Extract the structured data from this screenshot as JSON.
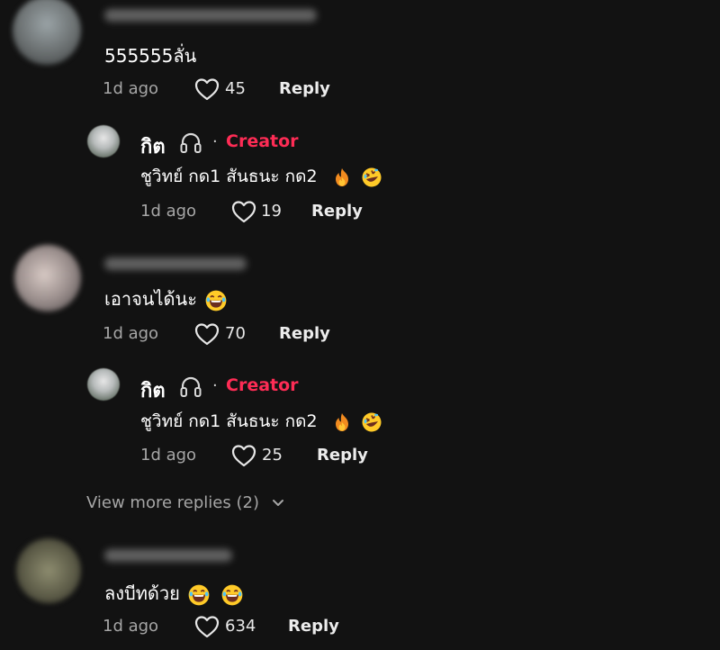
{
  "comments": [
    {
      "text": "555555ลั่น",
      "time": "1d ago",
      "likes": "45",
      "reply_label": "Reply",
      "reply": {
        "author": "กิต",
        "creator_label": "Creator",
        "text": "ชูวิทย์ กด1 สันธนะ กด2",
        "time": "1d ago",
        "likes": "19",
        "reply_label": "Reply"
      }
    },
    {
      "text": "เอาจนได้นะ",
      "time": "1d ago",
      "likes": "70",
      "reply_label": "Reply",
      "reply": {
        "author": "กิต",
        "creator_label": "Creator",
        "text": "ชูวิทย์ กด1 สันธนะ กด2",
        "time": "1d ago",
        "likes": "25",
        "reply_label": "Reply"
      },
      "view_more": "View more replies (2)"
    },
    {
      "text": "ลงบีทด้วย",
      "time": "1d ago",
      "likes": "634",
      "reply_label": "Reply"
    }
  ],
  "colors": {
    "background": "#121212",
    "creator": "#fe2c55",
    "meta": "#a6a6a6"
  },
  "icons": [
    "heart-outline-icon",
    "headphones-icon",
    "fire-emoji",
    "rofl-emoji",
    "laughing-emoji",
    "chevron-down-icon"
  ]
}
